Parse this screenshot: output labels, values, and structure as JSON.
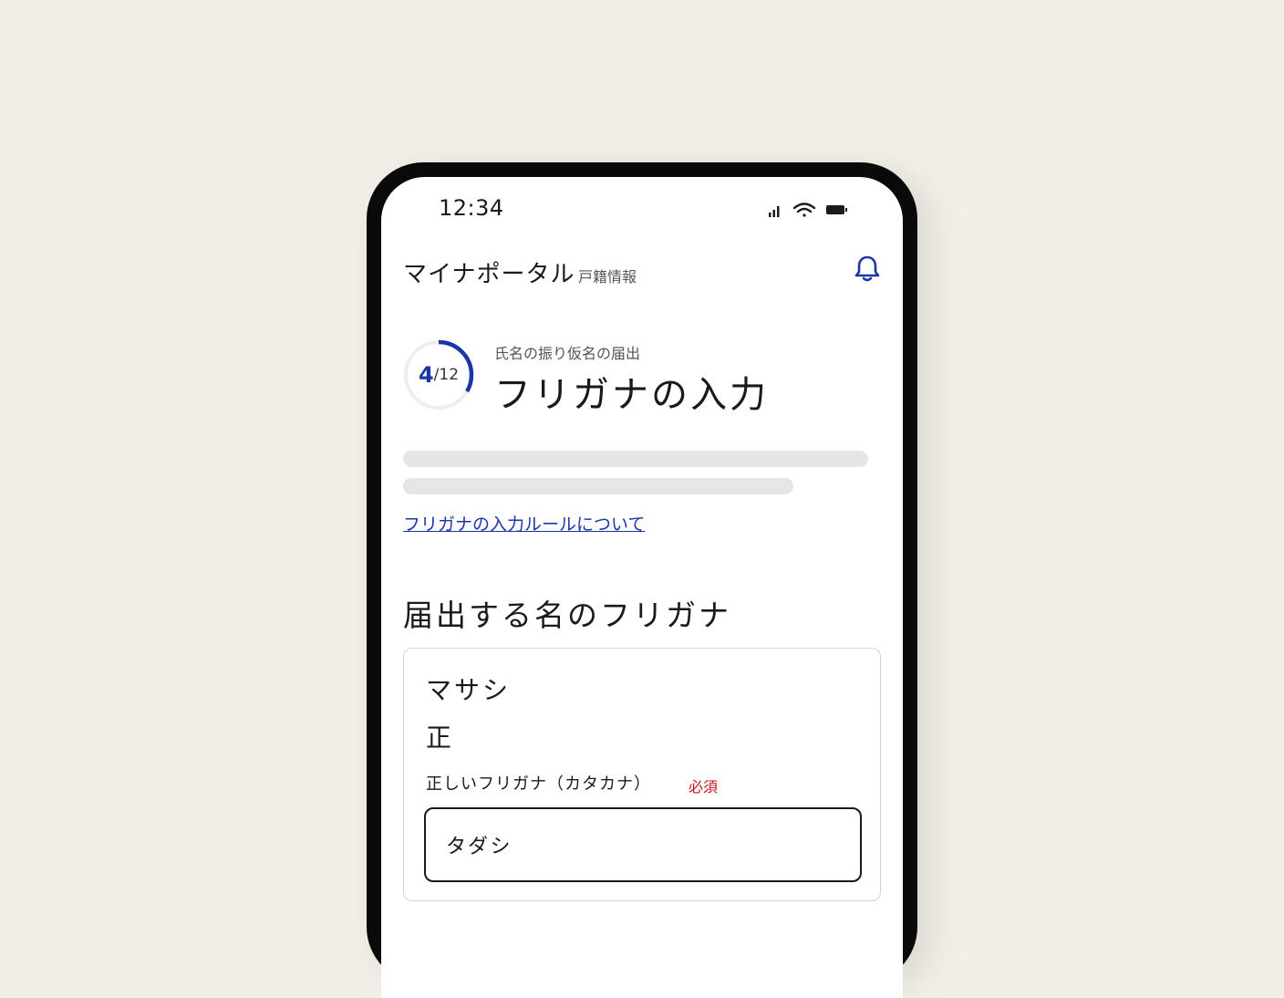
{
  "status_bar": {
    "time": "12:34",
    "icons": [
      "signal-icon",
      "wifi-icon",
      "battery-icon"
    ]
  },
  "header": {
    "title": "マイナポータル",
    "subtitle": "戸籍情報",
    "notification_icon": "bell-icon"
  },
  "progress": {
    "current": "4",
    "total": "/12",
    "fraction": 0.3333
  },
  "step": {
    "label": "氏名の振り仮名の届出",
    "title": "フリガナの入力"
  },
  "help_link": "フリガナの入力ルールについて",
  "section": {
    "title": "届出する名のフリガナ"
  },
  "card": {
    "kana": "マサシ",
    "kanji": "正",
    "field_label": "正しいフリガナ（カタカナ）",
    "required_label": "必須",
    "input_value": "タダシ"
  },
  "colors": {
    "accent": "#1a35a8",
    "required": "#c8161d",
    "background": "#f2efe7",
    "skeleton": "#e6e6e6"
  }
}
